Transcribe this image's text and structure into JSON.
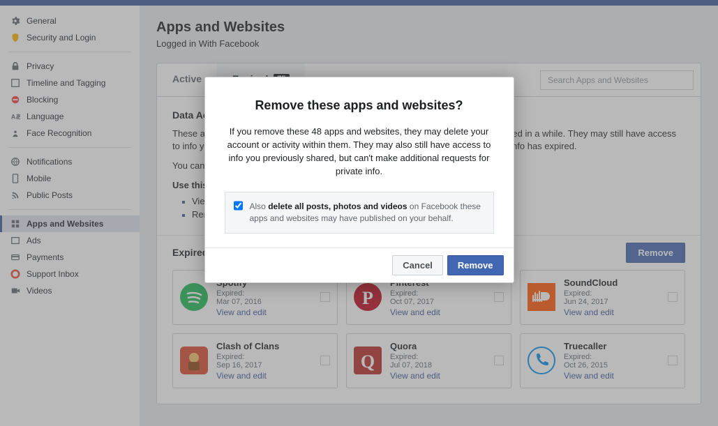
{
  "sidebar": {
    "groups": [
      [
        {
          "label": "General",
          "name": "sidebar-general",
          "icon": "gear-icon"
        },
        {
          "label": "Security and Login",
          "name": "sidebar-security",
          "icon": "shield-icon"
        }
      ],
      [
        {
          "label": "Privacy",
          "name": "sidebar-privacy",
          "icon": "lock-icon"
        },
        {
          "label": "Timeline and Tagging",
          "name": "sidebar-timeline",
          "icon": "tag-icon"
        },
        {
          "label": "Blocking",
          "name": "sidebar-blocking",
          "icon": "block-icon"
        },
        {
          "label": "Language",
          "name": "sidebar-language",
          "icon": "language-icon"
        },
        {
          "label": "Face Recognition",
          "name": "sidebar-face",
          "icon": "face-icon"
        }
      ],
      [
        {
          "label": "Notifications",
          "name": "sidebar-notifications",
          "icon": "globe-icon"
        },
        {
          "label": "Mobile",
          "name": "sidebar-mobile",
          "icon": "mobile-icon"
        },
        {
          "label": "Public Posts",
          "name": "sidebar-public",
          "icon": "rss-icon"
        }
      ],
      [
        {
          "label": "Apps and Websites",
          "name": "sidebar-apps",
          "icon": "apps-icon",
          "active": true
        },
        {
          "label": "Ads",
          "name": "sidebar-ads",
          "icon": "ads-icon"
        },
        {
          "label": "Payments",
          "name": "sidebar-payments",
          "icon": "card-icon"
        },
        {
          "label": "Support Inbox",
          "name": "sidebar-support",
          "icon": "lifesaver-icon"
        },
        {
          "label": "Videos",
          "name": "sidebar-videos",
          "icon": "video-icon"
        }
      ]
    ]
  },
  "page": {
    "title": "Apps and Websites",
    "subtitle": "Logged in With Facebook",
    "tabs": [
      {
        "label": "Active"
      },
      {
        "label": "Expired",
        "badge": "75",
        "active": true
      }
    ],
    "search_placeholder": "Search Apps and Websites",
    "section": {
      "heading": "Data Access Not Allowed",
      "p1": "These are apps and websites you've used Facebook to log into and may not have used in a while. They may still have access to info you previously shared, but their ability to make additional requests for private info has expired.",
      "p2": "You can still log into these apps and websites with Facebook.",
      "lead": "Use this list to:",
      "bullets": [
        "View and edit the info they have access to",
        "Remove the apps and websites you no longer want"
      ]
    },
    "list_title": "Expired Apps and Websites",
    "remove_btn": "Remove",
    "view_edit": "View and edit",
    "expired_label": "Expired:",
    "apps": [
      {
        "name": "Spotify",
        "date": "Mar 07, 2016",
        "color": "#1db954",
        "icon": "spotify"
      },
      {
        "name": "Pinterest",
        "date": "Oct 07, 2017",
        "color": "#bd081c",
        "icon": "pinterest"
      },
      {
        "name": "SoundCloud",
        "date": "Jun 24, 2017",
        "color": "#ff5500",
        "icon": "soundcloud"
      },
      {
        "name": "Clash of Clans",
        "date": "Sep 16, 2017",
        "color": "#d94a2e",
        "icon": "clash"
      },
      {
        "name": "Quora",
        "date": "Jul 07, 2018",
        "color": "#b92b27",
        "icon": "quora"
      },
      {
        "name": "Truecaller",
        "date": "Oct 26, 2015",
        "color": "#ffffff",
        "icon": "truecaller"
      }
    ]
  },
  "modal": {
    "title": "Remove these apps and websites?",
    "body": "If you remove these 48 apps and websites, they may delete your account or activity within them. They may also still have access to info you previously shared, but can't make additional requests for private info.",
    "also_prefix": "Also ",
    "also_bold": "delete all posts, photos and videos",
    "also_suffix": " on Facebook these apps and websites may have published on your behalf.",
    "cancel": "Cancel",
    "remove": "Remove"
  }
}
